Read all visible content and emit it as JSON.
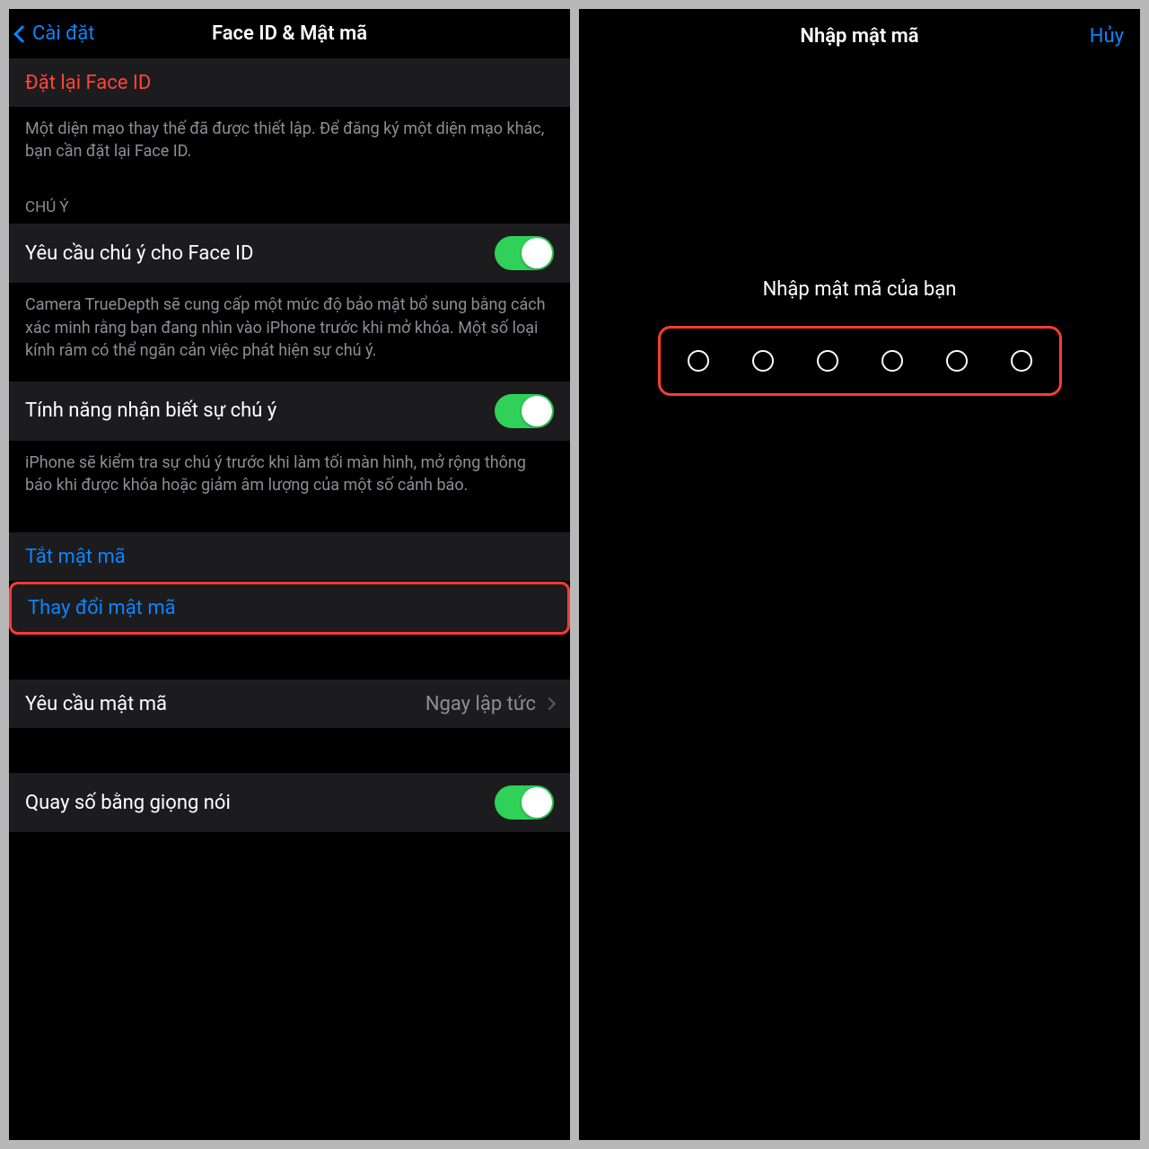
{
  "left": {
    "back_label": "Cài đặt",
    "title": "Face ID & Mật mã",
    "reset_faceid": "Đặt lại Face ID",
    "reset_footer": "Một diện mạo thay thế đã được thiết lập. Để đăng ký một diện mạo khác, bạn cần đặt lại Face ID.",
    "attention_header": "CHÚ Ý",
    "require_attention": "Yêu cầu chú ý cho Face ID",
    "require_attention_footer": "Camera TrueDepth sẽ cung cấp một mức độ bảo mật bổ sung bằng cách xác minh rằng bạn đang nhìn vào iPhone trước khi mở khóa. Một số loại kính râm có thể ngăn cản việc phát hiện sự chú ý.",
    "attention_aware": "Tính năng nhận biết sự chú ý",
    "attention_aware_footer": "iPhone sẽ kiểm tra sự chú ý trước khi làm tối màn hình, mở rộng thông báo khi được khóa hoặc giảm âm lượng của một số cảnh báo.",
    "turn_off_passcode": "Tắt mật mã",
    "change_passcode": "Thay đổi mật mã",
    "require_passcode_label": "Yêu cầu mật mã",
    "require_passcode_value": "Ngay lập tức",
    "voice_dial": "Quay số bằng giọng nói"
  },
  "right": {
    "title": "Nhập mật mã",
    "cancel": "Hủy",
    "prompt": "Nhập mật mã của bạn",
    "passcode_length": 6
  },
  "colors": {
    "blue": "#0a84ff",
    "red": "#ff453a",
    "green": "#30d158",
    "highlight": "#ff3b30"
  }
}
